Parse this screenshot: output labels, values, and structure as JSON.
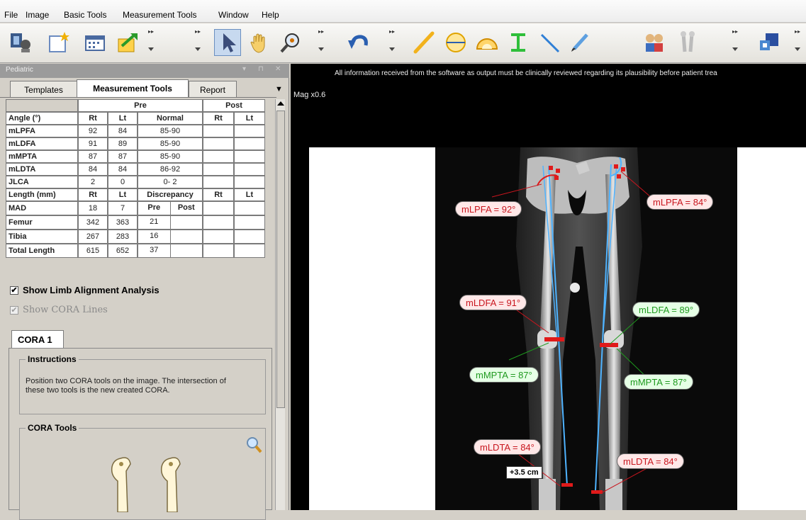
{
  "menu": [
    "File",
    "Image",
    "Basic Tools",
    "Measurement Tools",
    "Window",
    "Help"
  ],
  "toolbar_icons": [
    "patient-db-icon",
    "new-image-icon",
    "calendar-icon",
    "export-icon",
    "pointer-icon",
    "hand-pan-icon",
    "zoom-icon",
    "undo-icon",
    "ruler-line-icon",
    "circle-icon",
    "protractor-icon",
    "caliper-icon",
    "line-icon",
    "pen-icon",
    "compare-patients-icon",
    "bone-implant-icon",
    "tool-grid-icon"
  ],
  "panel": {
    "title": "Pediatric",
    "tabs": [
      "Templates",
      "Measurement Tools",
      "Report"
    ],
    "active_tab": "Measurement Tools",
    "table": {
      "group_pre": "Pre",
      "group_post": "Post",
      "angle_header": [
        "Angle (°)",
        "Rt",
        "Lt",
        "Normal",
        "Rt",
        "Lt"
      ],
      "angles": [
        {
          "name": "mLPFA",
          "rt": "92",
          "lt": "84",
          "normal": "85-90",
          "rt_color": "red",
          "lt_color": "red"
        },
        {
          "name": "mLDFA",
          "rt": "91",
          "lt": "89",
          "normal": "85-90",
          "rt_color": "red",
          "lt_color": "green"
        },
        {
          "name": "mMPTA",
          "rt": "87",
          "lt": "87",
          "normal": "85-90",
          "rt_color": "green",
          "lt_color": "green"
        },
        {
          "name": "mLDTA",
          "rt": "84",
          "lt": "84",
          "normal": "86-92",
          "rt_color": "red",
          "lt_color": "red"
        },
        {
          "name": "JLCA",
          "rt": "2",
          "lt": "0",
          "normal": "0- 2",
          "rt_color": "green",
          "lt_color": "green"
        }
      ],
      "length_header": [
        "Length (mm)",
        "Rt",
        "Lt",
        "Discrepancy",
        "Rt",
        "Lt"
      ],
      "mad": {
        "name": "MAD",
        "rt": "18",
        "lt": "7",
        "pre": "Pre",
        "post": "Post"
      },
      "lengths": [
        {
          "name": "Femur",
          "rt": "342",
          "lt": "363",
          "disc": "21"
        },
        {
          "name": "Tibia",
          "rt": "267",
          "lt": "283",
          "disc": "16"
        },
        {
          "name": "Total Length",
          "rt": "615",
          "lt": "652",
          "disc": "37"
        }
      ]
    },
    "show_limb": "Show Limb Alignment Analysis",
    "show_limb_checked": true,
    "show_cora": "Show CORA Lines",
    "show_cora_checked": true,
    "cora_tab": "CORA 1",
    "instructions_title": "Instructions",
    "instructions_text": "Position two CORA tools on the image. The intersection of these two tools is the new created CORA.",
    "cora_tools_title": "CORA Tools"
  },
  "viewer": {
    "warning": "All information received from the software as output must be clinically reviewed regarding its plausibility before patient trea",
    "mag": "Mag x0.6",
    "labels": {
      "r_lpfa": "mLPFA = 92°",
      "l_lpfa": "mLPFA = 84°",
      "r_ldfa": "mLDFA = 91°",
      "l_ldfa": "mLDFA = 89°",
      "r_mpta": "mMPTA = 87°",
      "l_mpta": "mMPTA = 87°",
      "r_ldta": "mLDTA = 84°",
      "l_ldta": "mLDTA = 84°"
    },
    "length_marker": "+3.5 cm"
  },
  "colors": {
    "red": "#d9171f",
    "green": "#27a127",
    "axis_line": "#4fb3ff"
  }
}
